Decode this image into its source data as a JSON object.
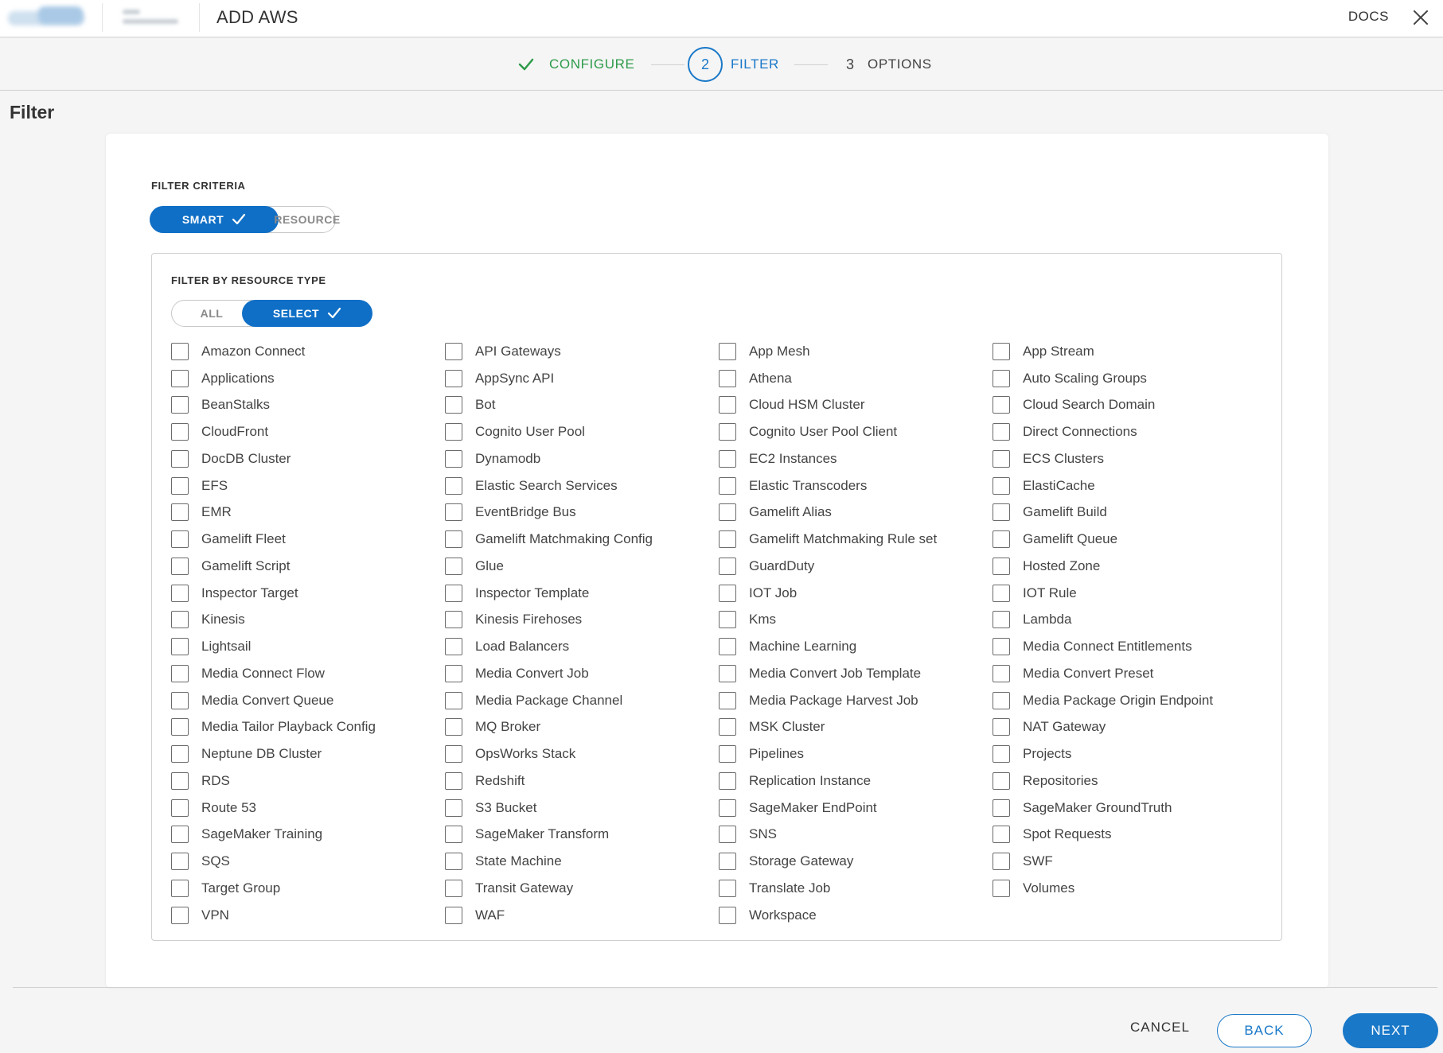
{
  "header": {
    "title": "ADD AWS",
    "docs_label": "DOCS"
  },
  "stepper": {
    "steps": [
      {
        "number": "1",
        "label": "CONFIGURE",
        "state": "done"
      },
      {
        "number": "2",
        "label": "FILTER",
        "state": "active"
      },
      {
        "number": "3",
        "label": "OPTIONS",
        "state": "pending"
      }
    ]
  },
  "page": {
    "title": "Filter"
  },
  "filter_criteria": {
    "label": "FILTER CRITERIA",
    "options": [
      {
        "label": "SMART",
        "selected": true
      },
      {
        "label": "RESOURCE",
        "selected": false
      }
    ]
  },
  "resource_type": {
    "label": "FILTER BY RESOURCE TYPE",
    "options": [
      {
        "label": "ALL",
        "selected": false
      },
      {
        "label": "SELECT",
        "selected": true
      }
    ],
    "items": [
      "Amazon Connect",
      "API Gateways",
      "App Mesh",
      "App Stream",
      "Applications",
      "AppSync API",
      "Athena",
      "Auto Scaling Groups",
      "BeanStalks",
      "Bot",
      "Cloud HSM Cluster",
      "Cloud Search Domain",
      "CloudFront",
      "Cognito User Pool",
      "Cognito User Pool Client",
      "Direct Connections",
      "DocDB Cluster",
      "Dynamodb",
      "EC2 Instances",
      "ECS Clusters",
      "EFS",
      "Elastic Search Services",
      "Elastic Transcoders",
      "ElastiCache",
      "EMR",
      "EventBridge Bus",
      "Gamelift Alias",
      "Gamelift Build",
      "Gamelift Fleet",
      "Gamelift Matchmaking Config",
      "Gamelift Matchmaking Rule set",
      "Gamelift Queue",
      "Gamelift Script",
      "Glue",
      "GuardDuty",
      "Hosted Zone",
      "Inspector Target",
      "Inspector Template",
      "IOT Job",
      "IOT Rule",
      "Kinesis",
      "Kinesis Firehoses",
      "Kms",
      "Lambda",
      "Lightsail",
      "Load Balancers",
      "Machine Learning",
      "Media Connect Entitlements",
      "Media Connect Flow",
      "Media Convert Job",
      "Media Convert Job Template",
      "Media Convert Preset",
      "Media Convert Queue",
      "Media Package Channel",
      "Media Package Harvest Job",
      "Media Package Origin Endpoint",
      "Media Tailor Playback Config",
      "MQ Broker",
      "MSK Cluster",
      "NAT Gateway",
      "Neptune DB Cluster",
      "OpsWorks Stack",
      "Pipelines",
      "Projects",
      "RDS",
      "Redshift",
      "Replication Instance",
      "Repositories",
      "Route 53",
      "S3 Bucket",
      "SageMaker EndPoint",
      "SageMaker GroundTruth",
      "SageMaker Training",
      "SageMaker Transform",
      "SNS",
      "Spot Requests",
      "SQS",
      "State Machine",
      "Storage Gateway",
      "SWF",
      "Target Group",
      "Transit Gateway",
      "Translate Job",
      "Volumes",
      "VPN",
      "WAF",
      "Workspace"
    ]
  },
  "footer": {
    "cancel_label": "CANCEL",
    "back_label": "BACK",
    "next_label": "NEXT"
  },
  "colors": {
    "primary": "#1978c8",
    "toggle_on": "#0f6fc6",
    "success": "#2e9b4a"
  },
  "icons": {
    "close": "close-icon",
    "step_done": "check-icon",
    "toggle_selected": "check-icon"
  }
}
